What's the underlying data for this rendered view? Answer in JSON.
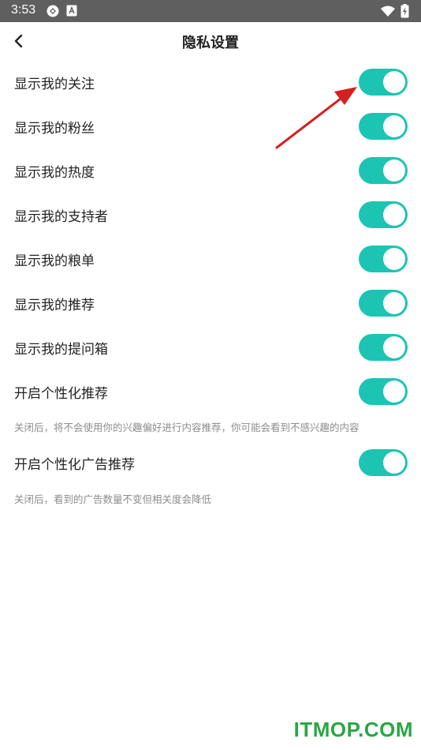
{
  "status_bar": {
    "time": "3:53",
    "icons": [
      "app-notification-icon",
      "text-notification-icon",
      "wifi-icon",
      "battery-charging-icon"
    ]
  },
  "header": {
    "title": "隐私设置",
    "back_icon": "chevron-left-icon"
  },
  "settings": [
    {
      "label": "显示我的关注",
      "enabled": true
    },
    {
      "label": "显示我的粉丝",
      "enabled": true
    },
    {
      "label": "显示我的热度",
      "enabled": true
    },
    {
      "label": "显示我的支持者",
      "enabled": true
    },
    {
      "label": "显示我的粮单",
      "enabled": true
    },
    {
      "label": "显示我的推荐",
      "enabled": true
    },
    {
      "label": "显示我的提问箱",
      "enabled": true
    },
    {
      "label": "开启个性化推荐",
      "enabled": true,
      "description": "关闭后，将不会使用你的兴趣偏好进行内容推荐，你可能会看到不感兴趣的内容"
    },
    {
      "label": "开启个性化广告推荐",
      "enabled": true,
      "description": "关闭后，看到的广告数量不变但相关度会降低"
    }
  ],
  "colors": {
    "toggle_on": "#1cc4b4",
    "status_bar": "#5f5f5f",
    "annotation_arrow": "#d42020",
    "watermark": "#2aa646"
  },
  "watermark": "ITMOP.COM"
}
